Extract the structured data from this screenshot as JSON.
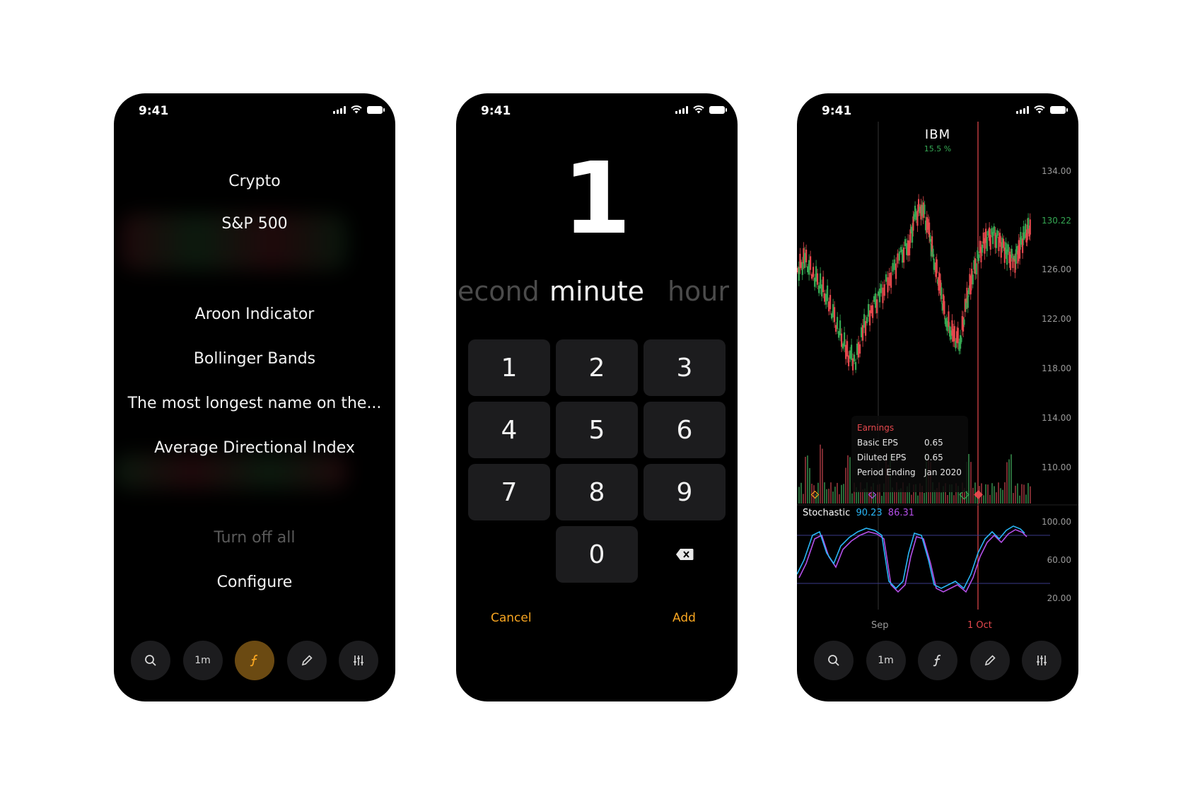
{
  "status": {
    "time": "9:41"
  },
  "phone1": {
    "menu": [
      {
        "label": "Crypto"
      },
      {
        "label": "S&P 500"
      },
      {
        "label": "Aroon Indicator"
      },
      {
        "label": "Bollinger Bands"
      },
      {
        "label": "The most longest name on the..."
      },
      {
        "label": "Average Directional Index"
      },
      {
        "label": "Turn off all"
      },
      {
        "label": "Configure"
      }
    ]
  },
  "toolbar": {
    "timeframe": "1m",
    "icons": [
      "search-icon",
      "function-icon",
      "pencil-icon",
      "sliders-icon"
    ],
    "active_color": "#f7a521"
  },
  "phone2": {
    "big_value": "1",
    "units": {
      "left": "econd",
      "center": "minute",
      "right": "hour"
    },
    "keys": [
      "1",
      "2",
      "3",
      "4",
      "5",
      "6",
      "7",
      "8",
      "9",
      "",
      "0",
      "backspace"
    ],
    "cancel": "Cancel",
    "add": "Add"
  },
  "phone3": {
    "ticker": "IBM",
    "change": "15.5 %",
    "price_labels": [
      "134.00",
      "130.22",
      "126.00",
      "122.00",
      "118.00",
      "114.00",
      "110.00"
    ],
    "current_price": "130.22",
    "osc_labels": [
      "100.00",
      "60.00",
      "20.00"
    ],
    "x_labels": [
      "Sep",
      "1 Oct"
    ],
    "tooltip": {
      "title": "Earnings",
      "rows": [
        {
          "label": "Basic EPS",
          "value": "0.65"
        },
        {
          "label": "Diluted EPS",
          "value": "0.65"
        },
        {
          "label": "Period Ending",
          "value": "Jan 2020"
        }
      ]
    },
    "stochastic": {
      "name": "Stochastic",
      "k": "90.23",
      "d": "86.31"
    },
    "colors": {
      "up": "#35a853",
      "down": "#e5484d",
      "k_line": "#29b6f6",
      "d_line": "#b44fe8",
      "marker": "#e5484d"
    }
  }
}
